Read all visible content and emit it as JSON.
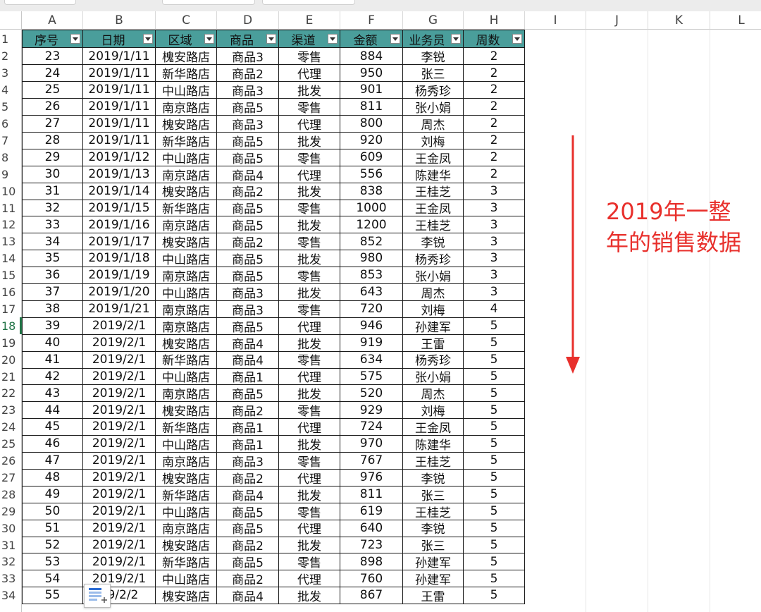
{
  "columns": [
    "A",
    "B",
    "C",
    "D",
    "E",
    "F",
    "G",
    "H",
    "I",
    "J",
    "K",
    "L"
  ],
  "header_row": {
    "row_number": "1",
    "labels": [
      "序号",
      "日期",
      "区域",
      "商品",
      "渠道",
      "金额",
      "业务员",
      "周数"
    ]
  },
  "rows": [
    {
      "r": "2",
      "cells": [
        "23",
        "2019/1/11",
        "槐安路店",
        "商品3",
        "零售",
        "884",
        "李锐",
        "2"
      ]
    },
    {
      "r": "3",
      "cells": [
        "24",
        "2019/1/11",
        "新华路店",
        "商品2",
        "代理",
        "950",
        "张三",
        "2"
      ]
    },
    {
      "r": "4",
      "cells": [
        "25",
        "2019/1/11",
        "中山路店",
        "商品3",
        "批发",
        "901",
        "杨秀珍",
        "2"
      ]
    },
    {
      "r": "5",
      "cells": [
        "26",
        "2019/1/11",
        "南京路店",
        "商品5",
        "零售",
        "811",
        "张小娟",
        "2"
      ]
    },
    {
      "r": "6",
      "cells": [
        "27",
        "2019/1/11",
        "槐安路店",
        "商品3",
        "代理",
        "800",
        "周杰",
        "2"
      ]
    },
    {
      "r": "7",
      "cells": [
        "28",
        "2019/1/11",
        "新华路店",
        "商品5",
        "批发",
        "920",
        "刘梅",
        "2"
      ]
    },
    {
      "r": "8",
      "cells": [
        "29",
        "2019/1/12",
        "中山路店",
        "商品5",
        "零售",
        "609",
        "王金凤",
        "2"
      ]
    },
    {
      "r": "9",
      "cells": [
        "30",
        "2019/1/13",
        "南京路店",
        "商品4",
        "代理",
        "556",
        "陈建华",
        "2"
      ]
    },
    {
      "r": "10",
      "cells": [
        "31",
        "2019/1/14",
        "槐安路店",
        "商品2",
        "批发",
        "838",
        "王桂芝",
        "3"
      ]
    },
    {
      "r": "11",
      "cells": [
        "32",
        "2019/1/15",
        "新华路店",
        "商品5",
        "零售",
        "1000",
        "王金凤",
        "3"
      ]
    },
    {
      "r": "12",
      "cells": [
        "33",
        "2019/1/16",
        "南京路店",
        "商品5",
        "批发",
        "1200",
        "王桂芝",
        "3"
      ]
    },
    {
      "r": "13",
      "cells": [
        "34",
        "2019/1/17",
        "槐安路店",
        "商品2",
        "零售",
        "852",
        "李锐",
        "3"
      ]
    },
    {
      "r": "14",
      "cells": [
        "35",
        "2019/1/18",
        "中山路店",
        "商品5",
        "批发",
        "980",
        "杨秀珍",
        "3"
      ]
    },
    {
      "r": "15",
      "cells": [
        "36",
        "2019/1/19",
        "南京路店",
        "商品5",
        "零售",
        "853",
        "张小娟",
        "3"
      ]
    },
    {
      "r": "16",
      "cells": [
        "37",
        "2019/1/20",
        "中山路店",
        "商品3",
        "批发",
        "643",
        "周杰",
        "3"
      ]
    },
    {
      "r": "17",
      "cells": [
        "38",
        "2019/1/21",
        "南京路店",
        "商品3",
        "零售",
        "720",
        "刘梅",
        "4"
      ]
    },
    {
      "r": "18",
      "cells": [
        "39",
        "2019/2/1",
        "南京路店",
        "商品5",
        "代理",
        "946",
        "孙建军",
        "5"
      ]
    },
    {
      "r": "19",
      "cells": [
        "40",
        "2019/2/1",
        "槐安路店",
        "商品4",
        "批发",
        "919",
        "王雷",
        "5"
      ]
    },
    {
      "r": "20",
      "cells": [
        "41",
        "2019/2/1",
        "新华路店",
        "商品4",
        "零售",
        "634",
        "杨秀珍",
        "5"
      ]
    },
    {
      "r": "21",
      "cells": [
        "42",
        "2019/2/1",
        "中山路店",
        "商品1",
        "代理",
        "575",
        "张小娟",
        "5"
      ]
    },
    {
      "r": "22",
      "cells": [
        "43",
        "2019/2/1",
        "南京路店",
        "商品5",
        "批发",
        "520",
        "周杰",
        "5"
      ]
    },
    {
      "r": "23",
      "cells": [
        "44",
        "2019/2/1",
        "槐安路店",
        "商品2",
        "零售",
        "929",
        "刘梅",
        "5"
      ]
    },
    {
      "r": "24",
      "cells": [
        "45",
        "2019/2/1",
        "新华路店",
        "商品1",
        "代理",
        "724",
        "王金凤",
        "5"
      ]
    },
    {
      "r": "25",
      "cells": [
        "46",
        "2019/2/1",
        "中山路店",
        "商品1",
        "批发",
        "970",
        "陈建华",
        "5"
      ]
    },
    {
      "r": "26",
      "cells": [
        "47",
        "2019/2/1",
        "南京路店",
        "商品3",
        "零售",
        "767",
        "王桂芝",
        "5"
      ]
    },
    {
      "r": "27",
      "cells": [
        "48",
        "2019/2/1",
        "槐安路店",
        "商品2",
        "代理",
        "976",
        "李锐",
        "5"
      ]
    },
    {
      "r": "28",
      "cells": [
        "49",
        "2019/2/1",
        "新华路店",
        "商品4",
        "批发",
        "811",
        "张三",
        "5"
      ]
    },
    {
      "r": "29",
      "cells": [
        "50",
        "2019/2/1",
        "中山路店",
        "商品5",
        "零售",
        "619",
        "王桂芝",
        "5"
      ]
    },
    {
      "r": "30",
      "cells": [
        "51",
        "2019/2/1",
        "南京路店",
        "商品5",
        "代理",
        "640",
        "李锐",
        "5"
      ]
    },
    {
      "r": "31",
      "cells": [
        "52",
        "2019/2/1",
        "槐安路店",
        "商品2",
        "批发",
        "723",
        "张三",
        "5"
      ]
    },
    {
      "r": "32",
      "cells": [
        "53",
        "2019/2/1",
        "新华路店",
        "商品5",
        "零售",
        "898",
        "孙建军",
        "5"
      ]
    },
    {
      "r": "33",
      "cells": [
        "54",
        "2019/2/1",
        "中山路店",
        "商品2",
        "代理",
        "760",
        "孙建军",
        "5"
      ]
    },
    {
      "r": "34",
      "cells": [
        "55",
        "19/2/2",
        "槐安路店",
        "商品4",
        "批发",
        "867",
        "王雷",
        "5"
      ]
    }
  ],
  "selected_row": "18",
  "annotation": {
    "lines": [
      "2019年一整",
      "年的销售数据"
    ],
    "color": "#e8302c"
  },
  "colors": {
    "header_fill": "#4a9e9b",
    "active_row_header": "#217346",
    "arrow": "#e8302c"
  },
  "icons": {
    "filter_button": "dropdown-arrow-icon",
    "quick_analysis": "quick-analysis-icon",
    "arrow": "down-arrow-icon"
  }
}
